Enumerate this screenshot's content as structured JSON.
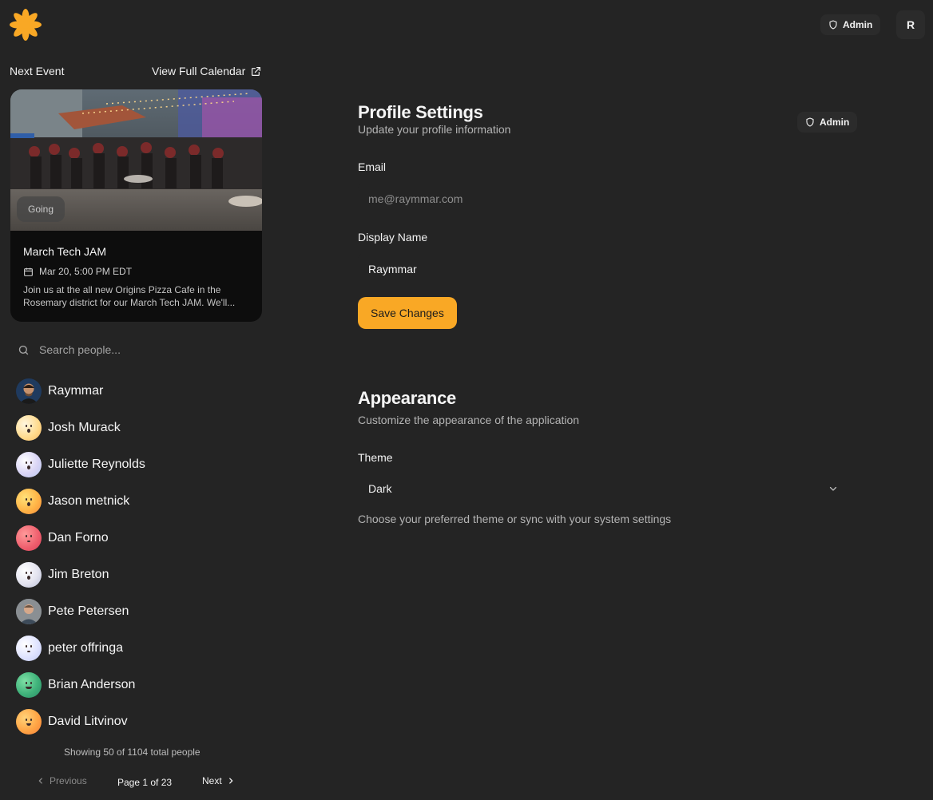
{
  "header": {
    "logo_icon": "asterisk-flower-logo",
    "brand_color": "#f9a825",
    "admin_badge": "Admin",
    "user_initial": "R"
  },
  "sidebar": {
    "next_event_label": "Next Event",
    "view_calendar_label": "View Full Calendar",
    "event": {
      "status": "Going",
      "title": "March Tech JAM",
      "datetime": "Mar 20, 5:00 PM EDT",
      "description": "Join us at the all new Origins Pizza Cafe in the Rosemary district for our March Tech JAM. We'll..."
    },
    "search": {
      "placeholder": "Search people..."
    },
    "people": [
      {
        "name": "Raymmar",
        "avatar": "photo"
      },
      {
        "name": "Josh Murack",
        "avatar": "gradient-face"
      },
      {
        "name": "Juliette Reynolds",
        "avatar": "gradient-face"
      },
      {
        "name": "Jason metnick",
        "avatar": "gradient-face"
      },
      {
        "name": "Dan Forno",
        "avatar": "gradient-face"
      },
      {
        "name": "Jim Breton",
        "avatar": "gradient-face"
      },
      {
        "name": "Pete Petersen",
        "avatar": "photo"
      },
      {
        "name": "peter offringa",
        "avatar": "gradient-face"
      },
      {
        "name": "Brian Anderson",
        "avatar": "gradient-face"
      },
      {
        "name": "David Litvinov",
        "avatar": "gradient-face"
      }
    ],
    "showing_text": "Showing 50 of 1104 total people",
    "pagination": {
      "previous": "Previous",
      "page_info": "Page 1 of 23",
      "next": "Next"
    }
  },
  "profile": {
    "title": "Profile Settings",
    "subtitle": "Update your profile information",
    "admin_badge": "Admin",
    "email_label": "Email",
    "email_placeholder": "me@raymmar.com",
    "display_name_label": "Display Name",
    "display_name_value": "Raymmar",
    "save_label": "Save Changes"
  },
  "appearance": {
    "title": "Appearance",
    "subtitle": "Customize the appearance of the application",
    "theme_label": "Theme",
    "theme_value": "Dark",
    "theme_help": "Choose your preferred theme or sync with your system settings"
  }
}
